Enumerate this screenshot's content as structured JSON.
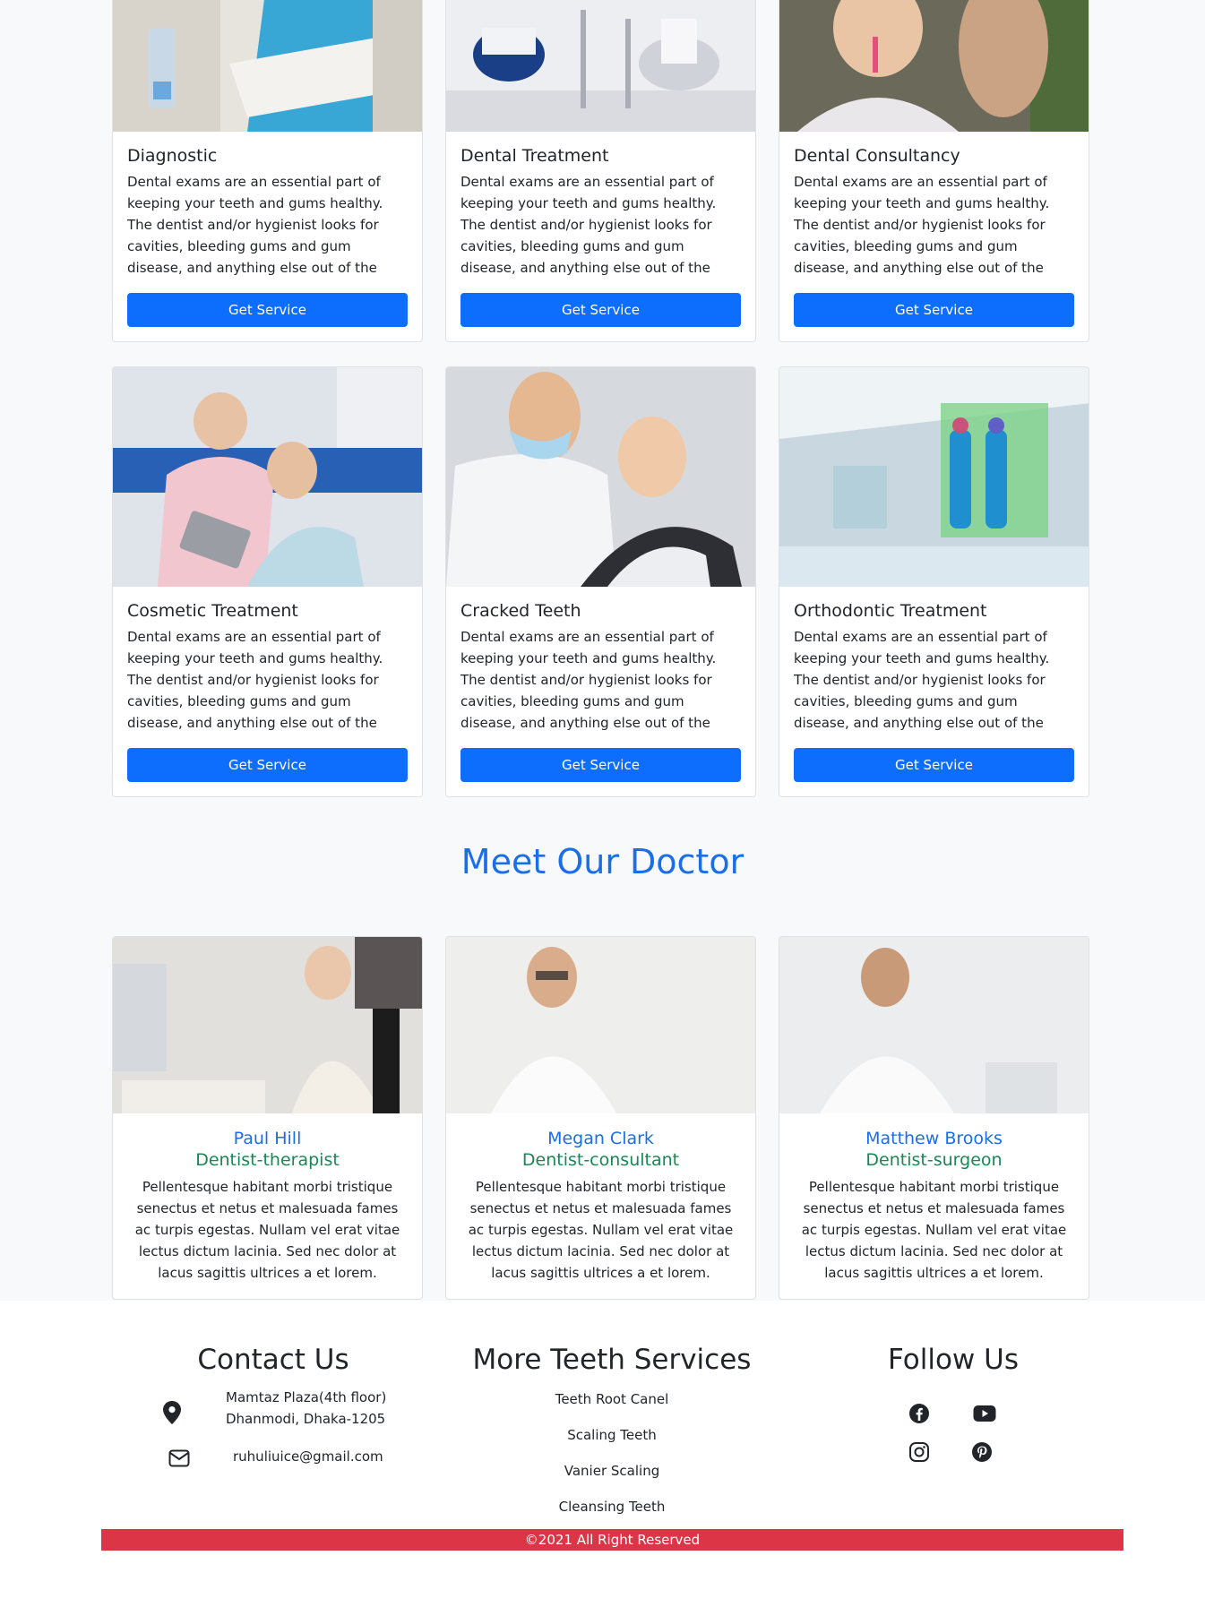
{
  "services": [
    {
      "title": "Diagnostic",
      "description": "Dental exams are an essential part of keeping your teeth and gums healthy. The dentist and/or hygienist looks for cavities, bleeding gums and gum disease, and anything else out of the ordinary in your",
      "button": "Get Service"
    },
    {
      "title": "Dental Treatment",
      "description": "Dental exams are an essential part of keeping your teeth and gums healthy. The dentist and/or hygienist looks for cavities, bleeding gums and gum disease, and anything else out of the ordinary in your",
      "button": "Get Service"
    },
    {
      "title": "Dental Consultancy",
      "description": "Dental exams are an essential part of keeping your teeth and gums healthy. The dentist and/or hygienist looks for cavities, bleeding gums and gum disease, and anything else out of the ordinary in your",
      "button": "Get Service"
    },
    {
      "title": "Cosmetic Treatment",
      "description": "Dental exams are an essential part of keeping your teeth and gums healthy. The dentist and/or hygienist looks for cavities, bleeding gums and gum disease, and anything else out of the ordinary in your",
      "button": "Get Service"
    },
    {
      "title": "Cracked Teeth",
      "description": "Dental exams are an essential part of keeping your teeth and gums healthy. The dentist and/or hygienist looks for cavities, bleeding gums and gum disease, and anything else out of the ordinary in your",
      "button": "Get Service"
    },
    {
      "title": "Orthodontic Treatment",
      "description": "Dental exams are an essential part of keeping your teeth and gums healthy. The dentist and/or hygienist looks for cavities, bleeding gums and gum disease, and anything else out of the ordinary in your",
      "button": "Get Service"
    }
  ],
  "doctors_section": {
    "title": "Meet Our Doctor",
    "doctors": [
      {
        "name": "Paul Hill",
        "role": "Dentist-therapist",
        "description": "Pellentesque habitant morbi tristique senectus et netus et malesuada fames ac turpis egestas. Nullam vel erat vitae lectus dictum lacinia. Sed nec dolor at lacus sagittis ultrices a et lorem."
      },
      {
        "name": "Megan Clark",
        "role": "Dentist-consultant",
        "description": "Pellentesque habitant morbi tristique senectus et netus et malesuada fames ac turpis egestas. Nullam vel erat vitae lectus dictum lacinia. Sed nec dolor at lacus sagittis ultrices a et lorem."
      },
      {
        "name": "Matthew Brooks",
        "role": "Dentist-surgeon",
        "description": "Pellentesque habitant morbi tristique senectus et netus et malesuada fames ac turpis egestas. Nullam vel erat vitae lectus dictum lacinia. Sed nec dolor at lacus sagittis ultrices a et lorem."
      }
    ]
  },
  "footer": {
    "contact": {
      "title": "Contact Us",
      "address_line1": "Mamtaz Plaza(4th floor)",
      "address_line2": "Dhanmodi, Dhaka-1205",
      "email": "ruhuliuice@gmail.com"
    },
    "more_services": {
      "title": "More Teeth Services",
      "items": [
        "Teeth Root Canel",
        "Scaling Teeth",
        "Vanier Scaling",
        "Cleansing Teeth"
      ]
    },
    "follow": {
      "title": "Follow Us",
      "icons": [
        "facebook-icon",
        "youtube-icon",
        "instagram-icon",
        "pinterest-icon"
      ]
    },
    "copyright": "©2021 All Right Reserved"
  },
  "colors": {
    "primary": "#0d6efd",
    "heading_blue": "#1a6ee8",
    "role_green": "#198754",
    "footer_bar": "#dc3545"
  }
}
